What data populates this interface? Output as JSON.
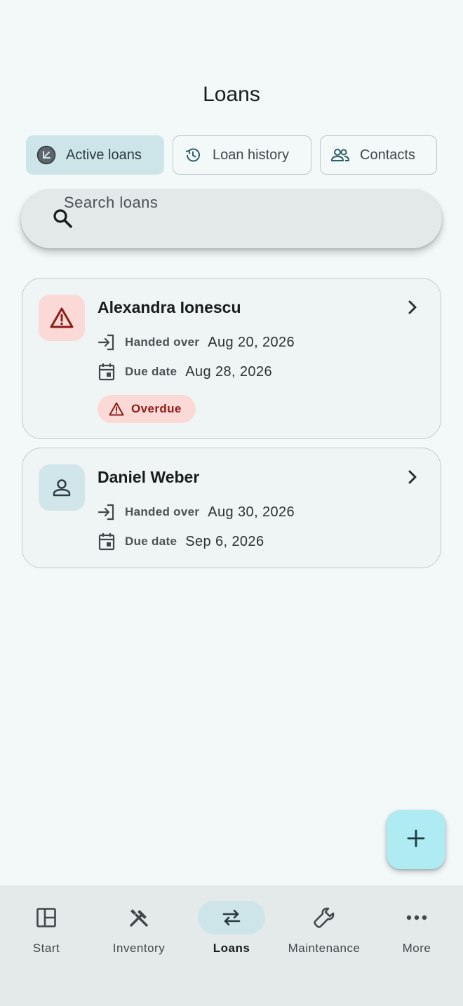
{
  "header": {
    "title": "Loans"
  },
  "filters": {
    "active_label": "Active loans",
    "history_label": "Loan history",
    "contacts_label": "Contacts",
    "selected": "Active loans"
  },
  "search": {
    "placeholder": "Search loans",
    "value": ""
  },
  "loans": [
    {
      "name": "Alexandra Ionescu",
      "avatar_icon": "warning-icon",
      "handed_over_label": "Handed over",
      "handed_over_date": "Aug 20, 2026",
      "due_label": "Due date",
      "due_date": "Aug 28, 2026",
      "status": "Overdue"
    },
    {
      "name": "Daniel Weber",
      "avatar_icon": "person-icon",
      "handed_over_label": "Handed over",
      "handed_over_date": "Aug 30, 2026",
      "due_label": "Due date",
      "due_date": "Sep 6, 2026"
    }
  ],
  "fab": {
    "icon": "add-icon"
  },
  "nav": {
    "items": [
      {
        "label": "Start",
        "icon": "dashboard-icon"
      },
      {
        "label": "Inventory",
        "icon": "tools-icon"
      },
      {
        "label": "Loans",
        "icon": "swap-icon"
      },
      {
        "label": "Maintenance",
        "icon": "wrench-icon"
      },
      {
        "label": "More",
        "icon": "more-icon"
      }
    ],
    "active": "Loans"
  },
  "colors": {
    "background": "#f3f9f9",
    "active_chip": "#cde5e9",
    "overdue_bg": "#fbd9d6",
    "overdue_text": "#8c1d18",
    "fab": "#afebf2"
  }
}
